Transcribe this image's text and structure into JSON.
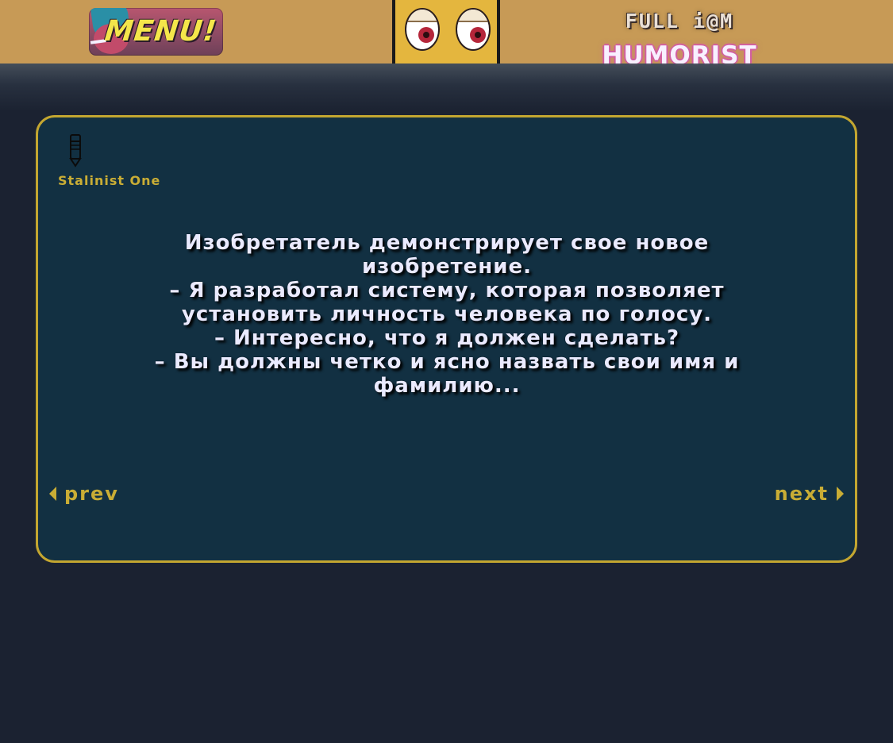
{
  "header": {
    "menu_label": "MENU!",
    "site_subtitle": "FULL i@M",
    "site_title": "HUMORIST",
    "mascot_icon": "eyes-icon"
  },
  "joke": {
    "author_icon": "pencil-icon",
    "author_name": "Stalinist One",
    "lines": [
      "Изобретатель демонстрирует свое новое изобретение.",
      "– Я разработал систему, которая позволяет установить личность человека по голосу.",
      "– Интересно, что я должен сделать?",
      "– Вы должны четко и ясно назвать свои имя и фамилию..."
    ]
  },
  "nav": {
    "prev_label": "prev",
    "next_label": "next"
  },
  "colors": {
    "header_bg": "#c79a56",
    "page_bg": "#1b2231",
    "card_bg": "#123042",
    "accent": "#c9ad35",
    "text": "#eaeaff",
    "title_glow": "#d25ea0"
  }
}
